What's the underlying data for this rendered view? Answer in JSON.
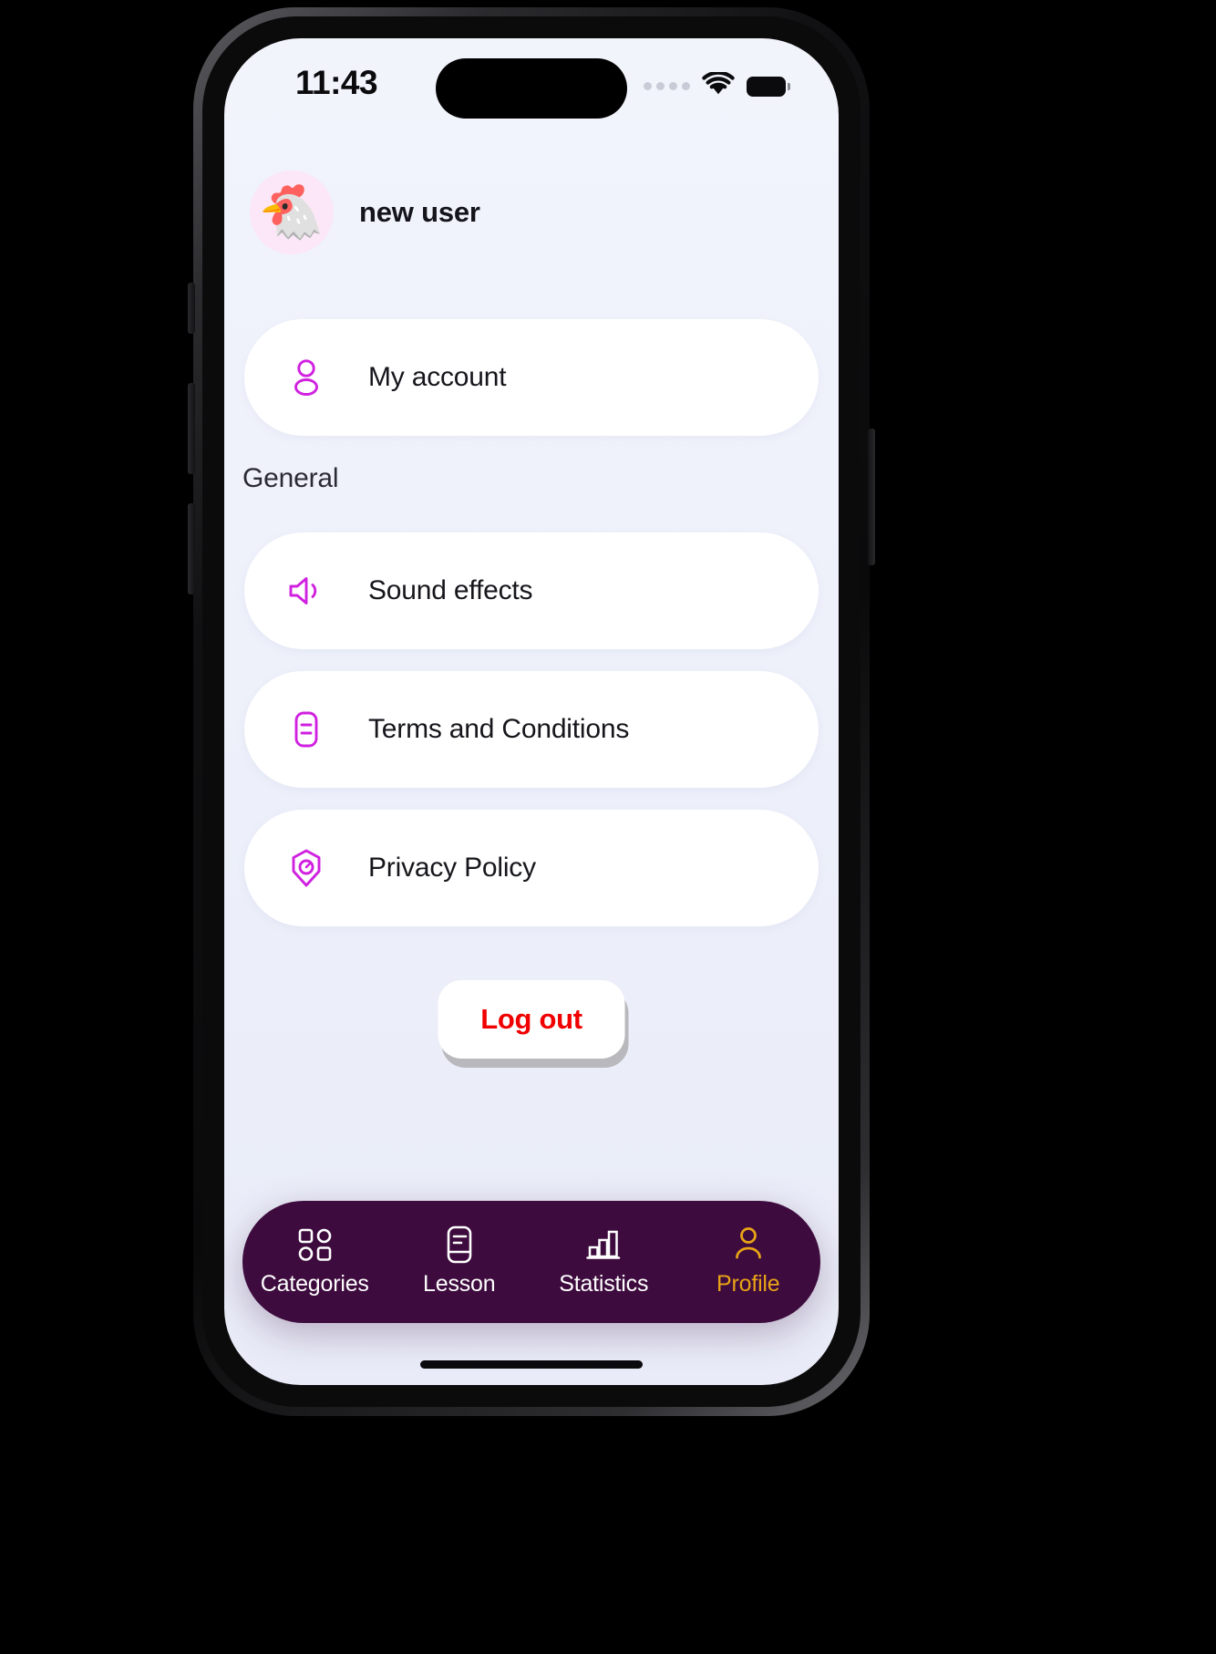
{
  "status_bar": {
    "time": "11:43",
    "cellular_icon": "cellular-dots-icon",
    "wifi_icon": "wifi-icon",
    "battery_icon": "battery-full-icon"
  },
  "header": {
    "avatar_icon": "chicken-avatar",
    "avatar_emoji": "🐔",
    "username": "new user"
  },
  "account_card": {
    "label": "My account",
    "icon": "user-icon"
  },
  "general": {
    "section_title": "General",
    "items": [
      {
        "label": "Sound effects",
        "icon": "volume-icon"
      },
      {
        "label": "Terms and Conditions",
        "icon": "document-icon"
      },
      {
        "label": "Privacy Policy",
        "icon": "shield-icon"
      }
    ]
  },
  "logout": {
    "label": "Log out"
  },
  "bottom_nav": {
    "items": [
      {
        "label": "Categories",
        "icon": "grid-icon",
        "active": false
      },
      {
        "label": "Lesson",
        "icon": "book-icon",
        "active": false
      },
      {
        "label": "Statistics",
        "icon": "bar-chart-icon",
        "active": false
      },
      {
        "label": "Profile",
        "icon": "person-icon",
        "active": true
      }
    ]
  },
  "colors": {
    "accent_magenta": "#d020e0",
    "nav_background": "#3d0b3d",
    "active_tab": "#e8a317",
    "logout_red": "#f00000",
    "screen_background": "#eef1fa",
    "card_background": "#ffffff"
  }
}
